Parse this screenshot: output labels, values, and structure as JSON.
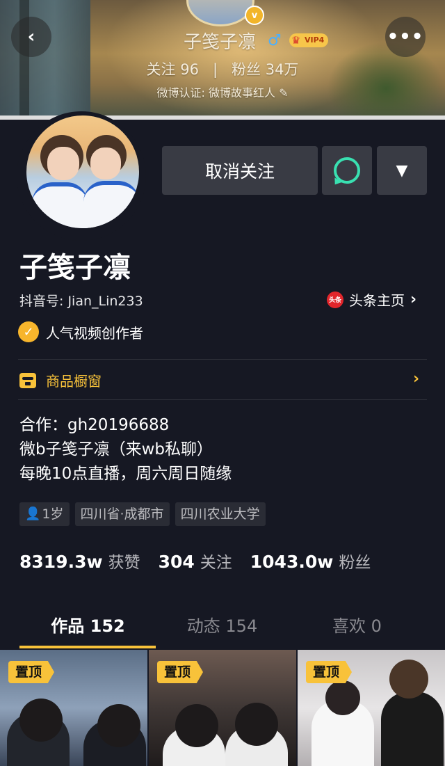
{
  "header": {
    "nickname": "子笺子凛",
    "gender_symbol": "♂",
    "vip_label": "VIP4",
    "follow_text": "关注 96",
    "fans_text": "粉丝 34万",
    "separator": "|",
    "cert_text": "微博认证: 微博故事红人 ✎",
    "verified_badge": "v",
    "back_icon": "‹",
    "more_icon": "•••"
  },
  "actions": {
    "unfollow_label": "取消关注",
    "dropdown_icon": "▼"
  },
  "profile": {
    "name": "子笺子凛",
    "douyin_id": "抖音号: Jian_Lin233",
    "toutiao_logo": "头条",
    "toutiao_label": "头条主页",
    "creator_label": "人气视频创作者",
    "shop_label": "商品橱窗",
    "bio_lines": [
      "合作：gh20196688",
      "微b子笺子凛（来wb私聊）",
      "每晚10点直播，周六周日随缘"
    ],
    "tags": [
      "1岁",
      "四川省·成都市",
      "四川农业大学"
    ]
  },
  "stats": [
    {
      "value": "8319.3w",
      "label": "获赞"
    },
    {
      "value": "304",
      "label": "关注"
    },
    {
      "value": "1043.0w",
      "label": "粉丝"
    }
  ],
  "tabs": [
    {
      "label": "作品 152"
    },
    {
      "label": "动态 154"
    },
    {
      "label": "喜欢 0"
    }
  ],
  "videos": [
    {
      "badge": "置顶"
    },
    {
      "badge": "置顶"
    },
    {
      "badge": "置顶"
    }
  ],
  "colors": {
    "background": "#161823",
    "accent_yellow": "#f8c23a",
    "message_green": "#39e0b1"
  }
}
